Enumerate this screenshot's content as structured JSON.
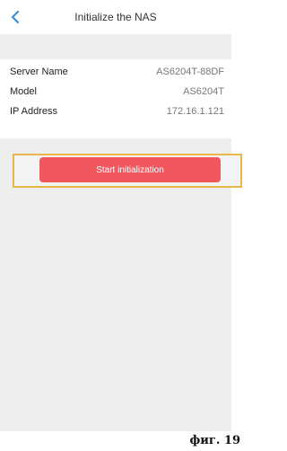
{
  "header": {
    "back_icon": "chevron-left-icon",
    "title": "Initialize the NAS",
    "accent": "#3b8fd6"
  },
  "info": {
    "rows": [
      {
        "label": "Server Name",
        "value": "AS6204T-88DF"
      },
      {
        "label": "Model",
        "value": "AS6204T"
      },
      {
        "label": "IP Address",
        "value": "172.16.1.121"
      }
    ]
  },
  "action": {
    "start_label": "Start initialization",
    "button_color": "#f0575f",
    "highlight_color": "#e8b64a"
  },
  "caption": "фиг. 19"
}
